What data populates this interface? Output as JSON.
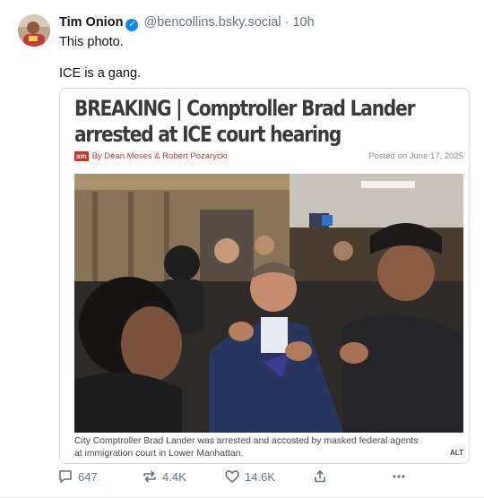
{
  "post": {
    "author_name": "Tim Onion",
    "verified_icon": "check-badge-icon",
    "handle": "@bencollins.bsky.social",
    "separator": "·",
    "time": "10h",
    "text_lines": [
      "This photo.",
      "ICE is a gang."
    ],
    "actions": {
      "replies": "647",
      "reposts": "4.4K",
      "likes": "14.6K"
    }
  },
  "embed": {
    "headline": "BREAKING | Comptroller Brad Lander arrested at ICE court hearing",
    "logo": "am",
    "byline": "By Dean Moses & Robert Pozarycki",
    "posted": "Posted on June 17, 2025",
    "caption": "City Comptroller Brad Lander was arrested and accosted by masked federal agents at immigration court in Lower Manhattan.",
    "alt_badge": "ALT"
  },
  "colors": {
    "verified": "#1083fe",
    "muted_text": "#66737f",
    "byline": "#c0392b",
    "logo_bg": "#d62e2e",
    "card_border": "#d4dbe2"
  }
}
